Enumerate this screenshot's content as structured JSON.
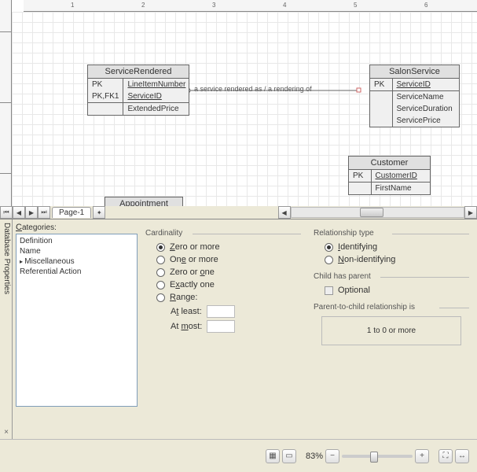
{
  "page_tab": "Page-1",
  "zoom": "83%",
  "entities": {
    "serviceRendered": {
      "title": "ServiceRendered",
      "rows": [
        {
          "pk": "PK",
          "field": "LineItemNumber",
          "u": true
        },
        {
          "pk": "PK,FK1",
          "field": "ServiceID",
          "u": true
        }
      ],
      "extra": [
        {
          "field": "ExtendedPrice"
        }
      ]
    },
    "salonService": {
      "title": "SalonService",
      "rows": [
        {
          "pk": "PK",
          "field": "ServiceID",
          "u": true
        }
      ],
      "extra": [
        {
          "field": "ServiceName"
        },
        {
          "field": "ServiceDuration"
        },
        {
          "field": "ServicePrice"
        }
      ]
    },
    "customer": {
      "title": "Customer",
      "rows": [
        {
          "pk": "PK",
          "field": "CustomerID",
          "u": true
        }
      ],
      "extra": [
        {
          "field": "FirstName"
        }
      ]
    },
    "appointment": {
      "title": "Appointment"
    }
  },
  "relationship_label": "a service rendered as / a rendering of",
  "panel": {
    "side_tab": "Database Properties",
    "categories_label": "Categories:",
    "categories": [
      "Definition",
      "Name",
      "Miscellaneous",
      "Referential Action"
    ],
    "selected_category": "Miscellaneous",
    "cardinality": {
      "title": "Cardinality",
      "options": [
        "Zero or more",
        "One or more",
        "Zero or one",
        "Exactly one",
        "Range:"
      ],
      "selected": "Zero or more",
      "at_least": "At least:",
      "at_most": "At most:"
    },
    "relationship_type": {
      "title": "Relationship type",
      "options": [
        "Identifying",
        "Non-identifying"
      ],
      "selected": "Identifying"
    },
    "child_has_parent": {
      "title": "Child has parent",
      "option": "Optional"
    },
    "parent_to_child": {
      "title": "Parent-to-child relationship is",
      "value": "1  to  0 or more"
    }
  },
  "chart_data": {
    "type": "erd",
    "entities": [
      {
        "name": "ServiceRendered",
        "pk": [
          "LineItemNumber",
          "ServiceID"
        ],
        "fk": {
          "ServiceID": "SalonService.ServiceID"
        },
        "attrs": [
          "ExtendedPrice"
        ]
      },
      {
        "name": "SalonService",
        "pk": [
          "ServiceID"
        ],
        "attrs": [
          "ServiceName",
          "ServiceDuration",
          "ServicePrice"
        ]
      },
      {
        "name": "Customer",
        "pk": [
          "CustomerID"
        ],
        "attrs": [
          "FirstName"
        ]
      },
      {
        "name": "Appointment",
        "pk": [],
        "attrs": []
      }
    ],
    "relationships": [
      {
        "from": "SalonService",
        "to": "ServiceRendered",
        "type": "identifying",
        "cardinality": "1 to 0..*",
        "label": "a service rendered as / a rendering of"
      }
    ]
  }
}
